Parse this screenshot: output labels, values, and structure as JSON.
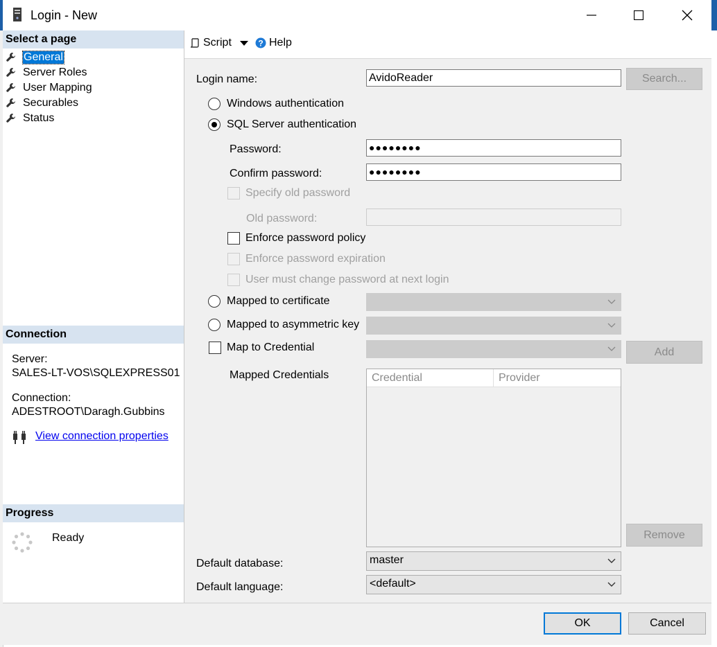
{
  "window": {
    "title": "Login - New",
    "icons": {
      "app": "server-icon",
      "minimize": "minimize-icon",
      "maximize": "maximize-icon",
      "close": "close-icon"
    }
  },
  "left_pane": {
    "select_page_header": "Select a page",
    "pages": [
      {
        "label": "General",
        "selected": true
      },
      {
        "label": "Server Roles",
        "selected": false
      },
      {
        "label": "User Mapping",
        "selected": false
      },
      {
        "label": "Securables",
        "selected": false
      },
      {
        "label": "Status",
        "selected": false
      }
    ],
    "connection": {
      "header": "Connection",
      "server_label": "Server:",
      "server_value": "SALES-LT-VOS\\SQLEXPRESS01",
      "connection_label": "Connection:",
      "connection_value": "ADESTROOT\\Daragh.Gubbins",
      "view_link": "View connection properties"
    },
    "progress": {
      "header": "Progress",
      "status": "Ready"
    }
  },
  "toolbar": {
    "script_label": "Script",
    "help_label": "Help"
  },
  "form": {
    "login_name_label": "Login name:",
    "login_name_value": "AvidoReader",
    "search_button": "Search...",
    "windows_auth_label": "Windows authentication",
    "sql_auth_label": "SQL Server authentication",
    "password_label": "Password:",
    "password_value": "●●●●●●●●",
    "confirm_password_label": "Confirm password:",
    "confirm_password_value": "●●●●●●●●",
    "specify_old_password_label": "Specify old password",
    "old_password_label": "Old password:",
    "enforce_policy_label": "Enforce password policy",
    "enforce_expiration_label": "Enforce password expiration",
    "must_change_label": "User must change password at next login",
    "mapped_certificate_label": "Mapped to certificate",
    "mapped_asymmetric_label": "Mapped to asymmetric key",
    "map_credential_label": "Map to Credential",
    "add_button": "Add",
    "mapped_credentials_label": "Mapped Credentials",
    "credential_columns": [
      "Credential",
      "Provider"
    ],
    "remove_button": "Remove",
    "default_database_label": "Default database:",
    "default_database_value": "master",
    "default_language_label": "Default language:",
    "default_language_value": "<default>"
  },
  "buttons": {
    "ok": "OK",
    "cancel": "Cancel"
  },
  "colors": {
    "selection": "#0078d7",
    "section_header": "#d7e3f0",
    "link": "#0000ee"
  }
}
